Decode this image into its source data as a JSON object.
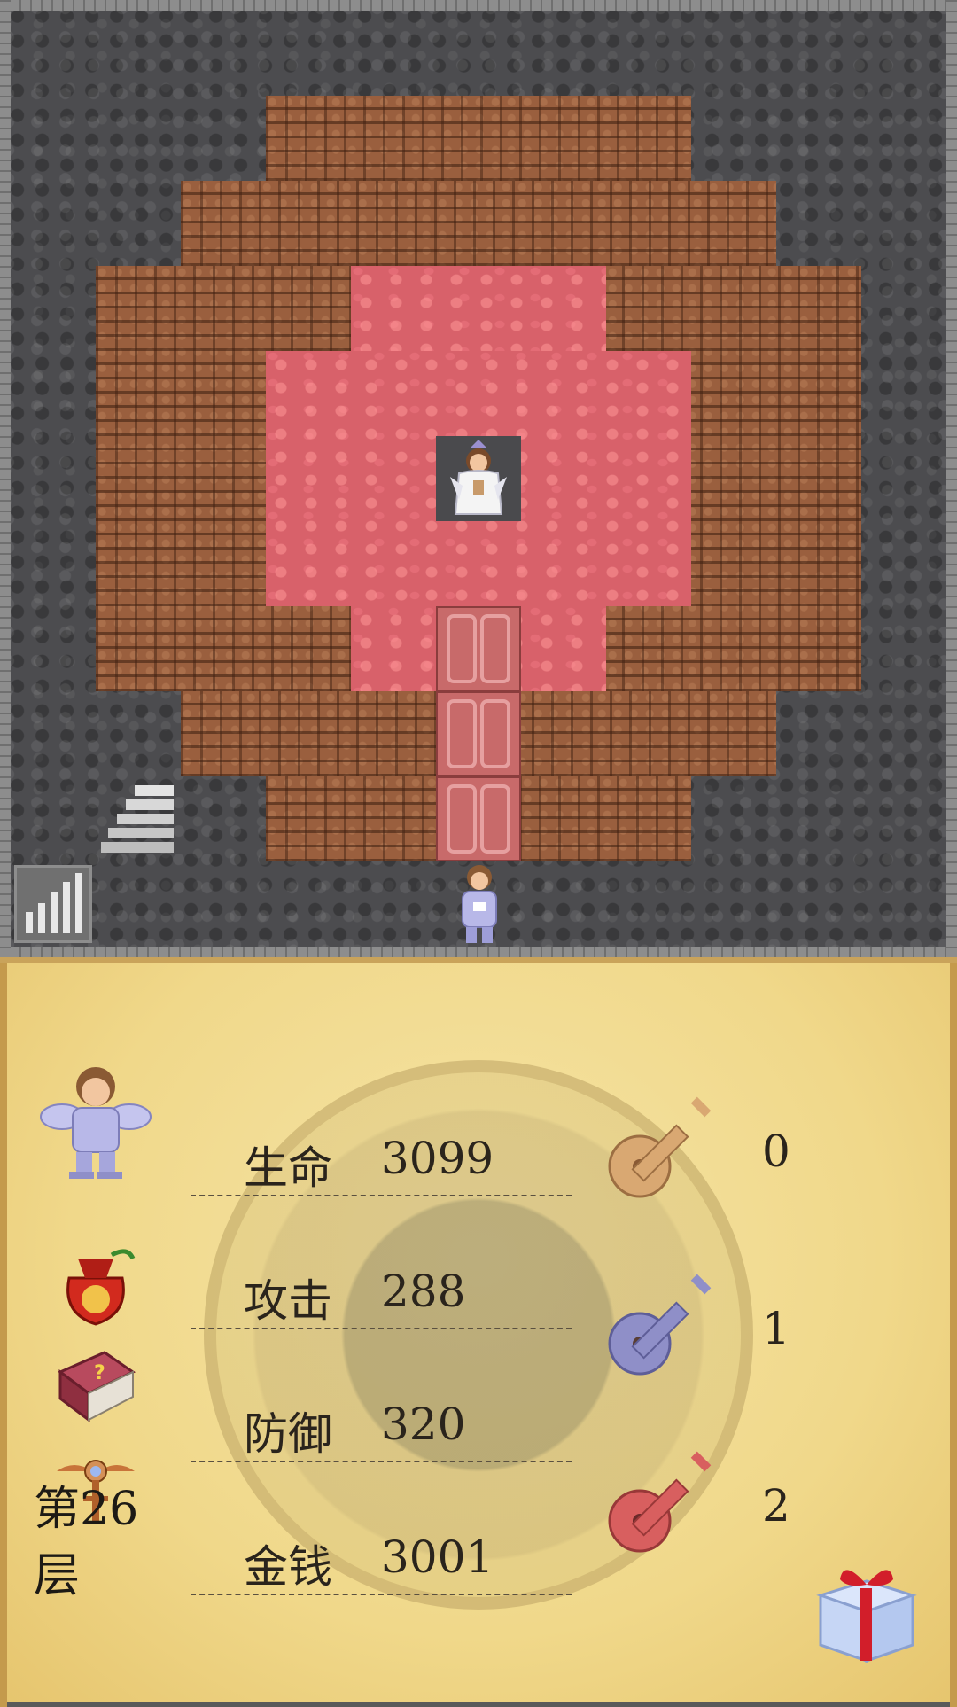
{
  "hud": {
    "floor": "第26层",
    "stats": [
      {
        "label": "生命",
        "value": "3099"
      },
      {
        "label": "攻击",
        "value": "288"
      },
      {
        "label": "防御",
        "value": "320"
      },
      {
        "label": "金钱",
        "value": "3001"
      }
    ],
    "keys": [
      {
        "color": "yellow",
        "count": "0"
      },
      {
        "color": "blue",
        "count": "1"
      },
      {
        "color": "red",
        "count": "2"
      }
    ]
  },
  "icons": {
    "hero_portrait": "hero-icon",
    "bag": "lucky-bag-icon",
    "book": "monster-book-icon",
    "fly": "floor-fly-icon",
    "gift": "gift-box-icon",
    "signal": "signal-icon",
    "stairs": "stairs-down-icon"
  },
  "colors": {
    "lava": "#d8616a",
    "brick": "#9a5f3e",
    "wall": "#4c4c4f",
    "panel": "#f0d88a",
    "key_yellow": "#d9a872",
    "key_blue": "#8f8fc8",
    "key_red": "#d85f5f"
  }
}
